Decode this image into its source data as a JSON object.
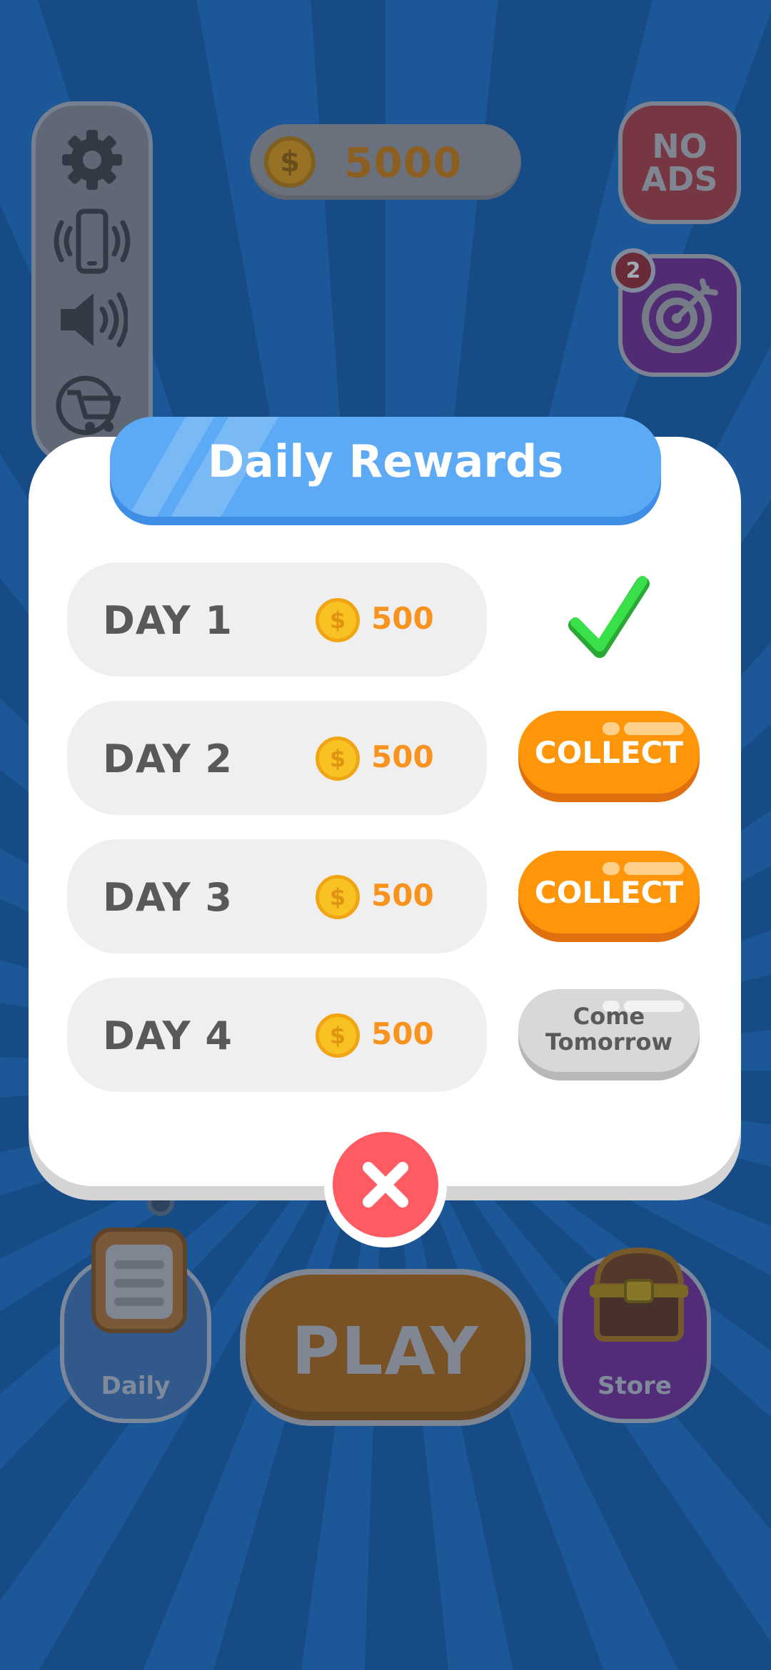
{
  "hud": {
    "coins": "5000",
    "no_ads_label": "NO\nADS",
    "quest_badge": "2"
  },
  "side_menu": {
    "icons": [
      "gear-icon",
      "vibration-icon",
      "sound-icon",
      "shop-icon"
    ]
  },
  "bottom_bar": {
    "daily_label": "Daily",
    "play_label": "PLAY",
    "store_label": "Store"
  },
  "modal": {
    "title": "Daily Rewards",
    "rows": [
      {
        "day": "DAY 1",
        "amount": "500",
        "status": "collected"
      },
      {
        "day": "DAY 2",
        "amount": "500",
        "status": "collect",
        "button_label": "COLLECT"
      },
      {
        "day": "DAY 3",
        "amount": "500",
        "status": "collect",
        "button_label": "COLLECT"
      },
      {
        "day": "DAY 4",
        "amount": "500",
        "status": "locked",
        "button_label": "Come\nTomorrow"
      }
    ],
    "coin_symbol": "$"
  },
  "colors": {
    "background": "#1b5ea3",
    "title_banner": "#5caaf5",
    "collect_button": "#ff9508",
    "close_button": "#ff5b62",
    "check": "#39e04a",
    "reward_amount": "#f7931e"
  }
}
